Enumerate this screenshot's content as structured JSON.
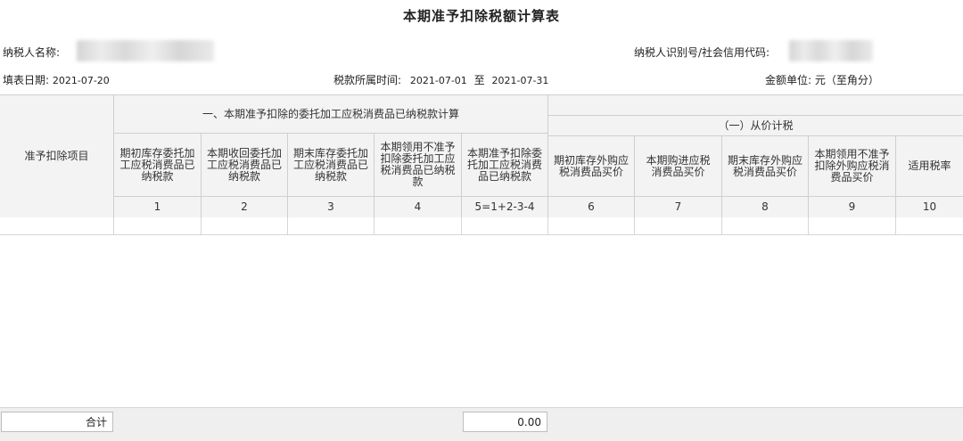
{
  "title": "本期准予扣除税额计算表",
  "info": {
    "taxpayer_name_label": "纳税人名称:",
    "taxpayer_id_label": "纳税人识别号/社会信用代码:",
    "fill_date_label": "填表日期:",
    "fill_date": "2021-07-20",
    "period_label": "税款所属时间:",
    "period_start": "2021-07-01",
    "period_sep": "至",
    "period_end": "2021-07-31",
    "unit_label": "金额单位:",
    "unit_value": "元（至角分）"
  },
  "table": {
    "row_header": "准予扣除项目",
    "group1": "一、本期准予扣除的委托加工应税消费品已纳税款计算",
    "group2_sub": "（一）从价计税",
    "columns": [
      {
        "label": "期初库存委托加工应税消费品已纳税款",
        "num": "1"
      },
      {
        "label": "本期收回委托加工应税消费品已纳税款",
        "num": "2"
      },
      {
        "label": "期末库存委托加工应税消费品已纳税款",
        "num": "3"
      },
      {
        "label": "本期领用不准予扣除委托加工应税消费品已纳税款",
        "num": "4"
      },
      {
        "label": "本期准予扣除委托加工应税消费品已纳税款",
        "num": "5=1+2-3-4"
      },
      {
        "label": "期初库存外购应税消费品买价",
        "num": "6"
      },
      {
        "label": "本期购进应税消费品买价",
        "num": "7"
      },
      {
        "label": "期末库存外购应税消费品买价",
        "num": "8"
      },
      {
        "label": "本期领用不准予扣除外购应税消费品买价",
        "num": "9"
      },
      {
        "label": "适用税率",
        "num": "10"
      }
    ]
  },
  "footer": {
    "total_label": "合计",
    "total_value": "0.00"
  }
}
